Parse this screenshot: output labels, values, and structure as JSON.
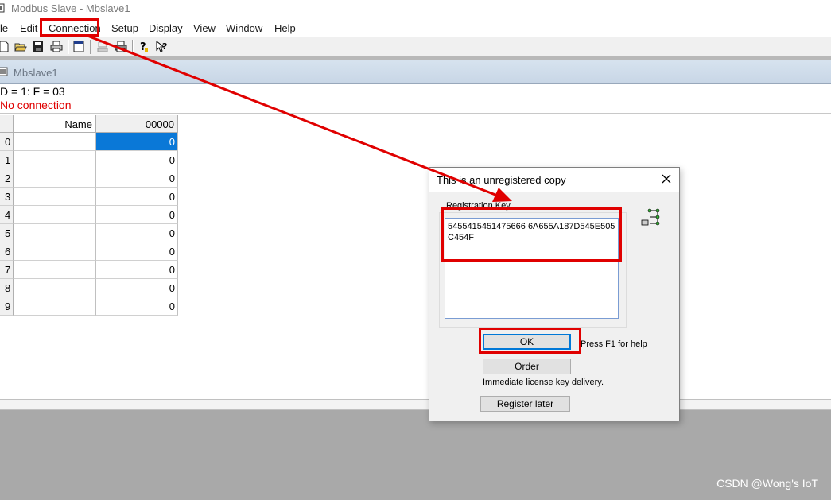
{
  "window": {
    "title": "Modbus Slave - Mbslave1"
  },
  "menu": {
    "items": [
      "le",
      "Edit",
      "Connection",
      "Setup",
      "Display",
      "View",
      "Window",
      "Help"
    ]
  },
  "child": {
    "title": "Mbslave1",
    "status_line": "D = 1: F = 03",
    "connection_status": "No connection"
  },
  "grid": {
    "col_name": "Name",
    "col_value": "00000",
    "rows": [
      {
        "num": "0",
        "value": "0",
        "selected": true
      },
      {
        "num": "1",
        "value": "0"
      },
      {
        "num": "2",
        "value": "0"
      },
      {
        "num": "3",
        "value": "0"
      },
      {
        "num": "4",
        "value": "0"
      },
      {
        "num": "5",
        "value": "0"
      },
      {
        "num": "6",
        "value": "0"
      },
      {
        "num": "7",
        "value": "0"
      },
      {
        "num": "8",
        "value": "0"
      },
      {
        "num": "9",
        "value": "0"
      }
    ]
  },
  "dialog": {
    "title": "This is an unregistered copy",
    "group_label": "Registration Key",
    "key_value": "5455415451475666 6A655A187D545E505C454F",
    "ok_label": "OK",
    "help_text": "Press F1 for help",
    "order_label": "Order",
    "order_note": "Immediate license key delivery.",
    "register_later_label": "Register later"
  },
  "watermark": "CSDN @Wong's IoT",
  "colors": {
    "annotation_red": "#e00000",
    "selection_blue": "#0a78d7",
    "error_text": "#e00000"
  },
  "icons": {
    "app": "modbus-slave-icon",
    "toolbar": [
      "new-file-icon",
      "open-folder-icon",
      "save-icon",
      "print-icon",
      "window-icon",
      "connect-icon",
      "print-preview-icon",
      "help-icon",
      "context-help-icon"
    ],
    "dialog": "network-icon",
    "close": "close-icon"
  }
}
